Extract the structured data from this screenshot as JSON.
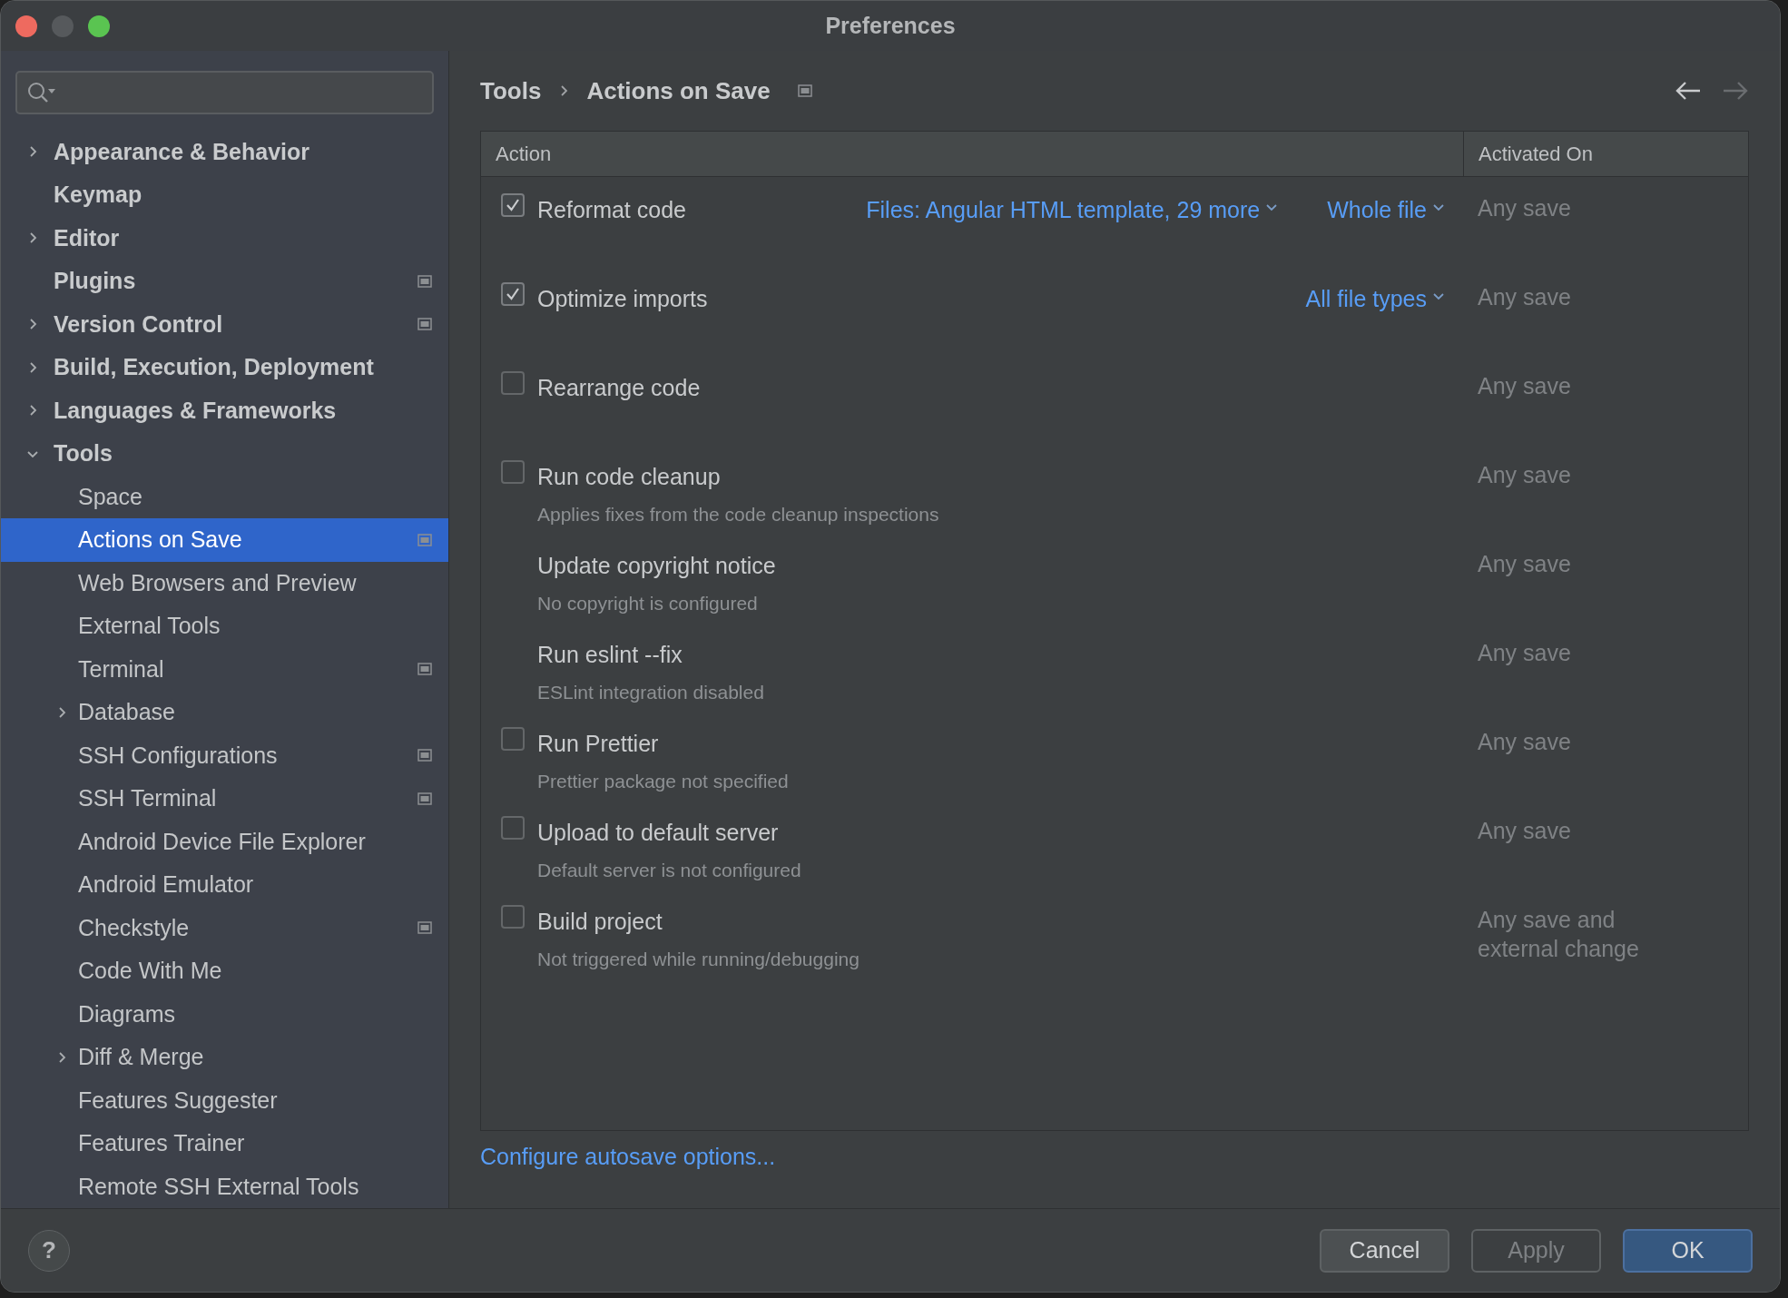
{
  "window": {
    "title": "Preferences"
  },
  "sidebar": {
    "items": [
      {
        "label": "Appearance & Behavior",
        "expandable": true,
        "expanded": false,
        "project_icon": false,
        "selected": false
      },
      {
        "label": "Keymap",
        "expandable": false,
        "expanded": false,
        "project_icon": false,
        "selected": false
      },
      {
        "label": "Editor",
        "expandable": true,
        "expanded": false,
        "project_icon": false,
        "selected": false
      },
      {
        "label": "Plugins",
        "expandable": false,
        "expanded": false,
        "project_icon": true,
        "selected": false
      },
      {
        "label": "Version Control",
        "expandable": true,
        "expanded": false,
        "project_icon": true,
        "selected": false
      },
      {
        "label": "Build, Execution, Deployment",
        "expandable": true,
        "expanded": false,
        "project_icon": false,
        "selected": false
      },
      {
        "label": "Languages & Frameworks",
        "expandable": true,
        "expanded": false,
        "project_icon": false,
        "selected": false
      },
      {
        "label": "Tools",
        "expandable": true,
        "expanded": true,
        "project_icon": false,
        "selected": false,
        "children": [
          {
            "label": "Space",
            "expandable": false,
            "expanded": false,
            "project_icon": false,
            "selected": false
          },
          {
            "label": "Actions on Save",
            "expandable": false,
            "expanded": false,
            "project_icon": true,
            "selected": true
          },
          {
            "label": "Web Browsers and Preview",
            "expandable": false,
            "expanded": false,
            "project_icon": false,
            "selected": false
          },
          {
            "label": "External Tools",
            "expandable": false,
            "expanded": false,
            "project_icon": false,
            "selected": false
          },
          {
            "label": "Terminal",
            "expandable": false,
            "expanded": false,
            "project_icon": true,
            "selected": false
          },
          {
            "label": "Database",
            "expandable": true,
            "expanded": false,
            "project_icon": false,
            "selected": false
          },
          {
            "label": "SSH Configurations",
            "expandable": false,
            "expanded": false,
            "project_icon": true,
            "selected": false
          },
          {
            "label": "SSH Terminal",
            "expandable": false,
            "expanded": false,
            "project_icon": true,
            "selected": false
          },
          {
            "label": "Android Device File Explorer",
            "expandable": false,
            "expanded": false,
            "project_icon": false,
            "selected": false
          },
          {
            "label": "Android Emulator",
            "expandable": false,
            "expanded": false,
            "project_icon": false,
            "selected": false
          },
          {
            "label": "Checkstyle",
            "expandable": false,
            "expanded": false,
            "project_icon": true,
            "selected": false
          },
          {
            "label": "Code With Me",
            "expandable": false,
            "expanded": false,
            "project_icon": false,
            "selected": false
          },
          {
            "label": "Diagrams",
            "expandable": false,
            "expanded": false,
            "project_icon": false,
            "selected": false
          },
          {
            "label": "Diff & Merge",
            "expandable": true,
            "expanded": false,
            "project_icon": false,
            "selected": false
          },
          {
            "label": "Features Suggester",
            "expandable": false,
            "expanded": false,
            "project_icon": false,
            "selected": false
          },
          {
            "label": "Features Trainer",
            "expandable": false,
            "expanded": false,
            "project_icon": false,
            "selected": false
          },
          {
            "label": "Remote SSH External Tools",
            "expandable": false,
            "expanded": false,
            "project_icon": false,
            "selected": false
          }
        ]
      }
    ]
  },
  "breadcrumb": [
    "Tools",
    "Actions on Save"
  ],
  "table": {
    "columns": [
      "Action",
      "Activated On"
    ],
    "rows": [
      {
        "kind": "checkbox",
        "checked": true,
        "name": "Reformat code",
        "options": [
          "Files: Angular HTML template, 29 more",
          "Whole file"
        ],
        "activated_on": "Any save"
      },
      {
        "kind": "checkbox",
        "checked": true,
        "name": "Optimize imports",
        "options": [
          "All file types"
        ],
        "activated_on": "Any save"
      },
      {
        "kind": "checkbox",
        "checked": false,
        "name": "Rearrange code",
        "activated_on": "Any save"
      },
      {
        "kind": "checkbox",
        "checked": false,
        "name": "Run code cleanup",
        "note": "Applies fixes from the code cleanup inspections",
        "activated_on": "Any save"
      },
      {
        "kind": "plain",
        "name": "Update copyright notice",
        "note": "No copyright is configured",
        "activated_on": "Any save"
      },
      {
        "kind": "plain",
        "name": "Run eslint --fix",
        "note": "ESLint integration disabled",
        "activated_on": "Any save"
      },
      {
        "kind": "checkbox",
        "checked": false,
        "name": "Run Prettier",
        "note": "Prettier package not specified",
        "activated_on": "Any save"
      },
      {
        "kind": "checkbox",
        "checked": false,
        "name": "Upload to default server",
        "note": "Default server is not configured",
        "activated_on": "Any save"
      },
      {
        "kind": "checkbox",
        "checked": false,
        "name": "Build project",
        "note": "Not triggered while running/debugging",
        "activated_on": "Any save and external change"
      }
    ]
  },
  "link": "Configure autosave options...",
  "help": "?",
  "buttons": [
    {
      "label": "Cancel",
      "kind": "normal"
    },
    {
      "label": "Apply",
      "kind": "disabled"
    },
    {
      "label": "OK",
      "kind": "default"
    }
  ]
}
